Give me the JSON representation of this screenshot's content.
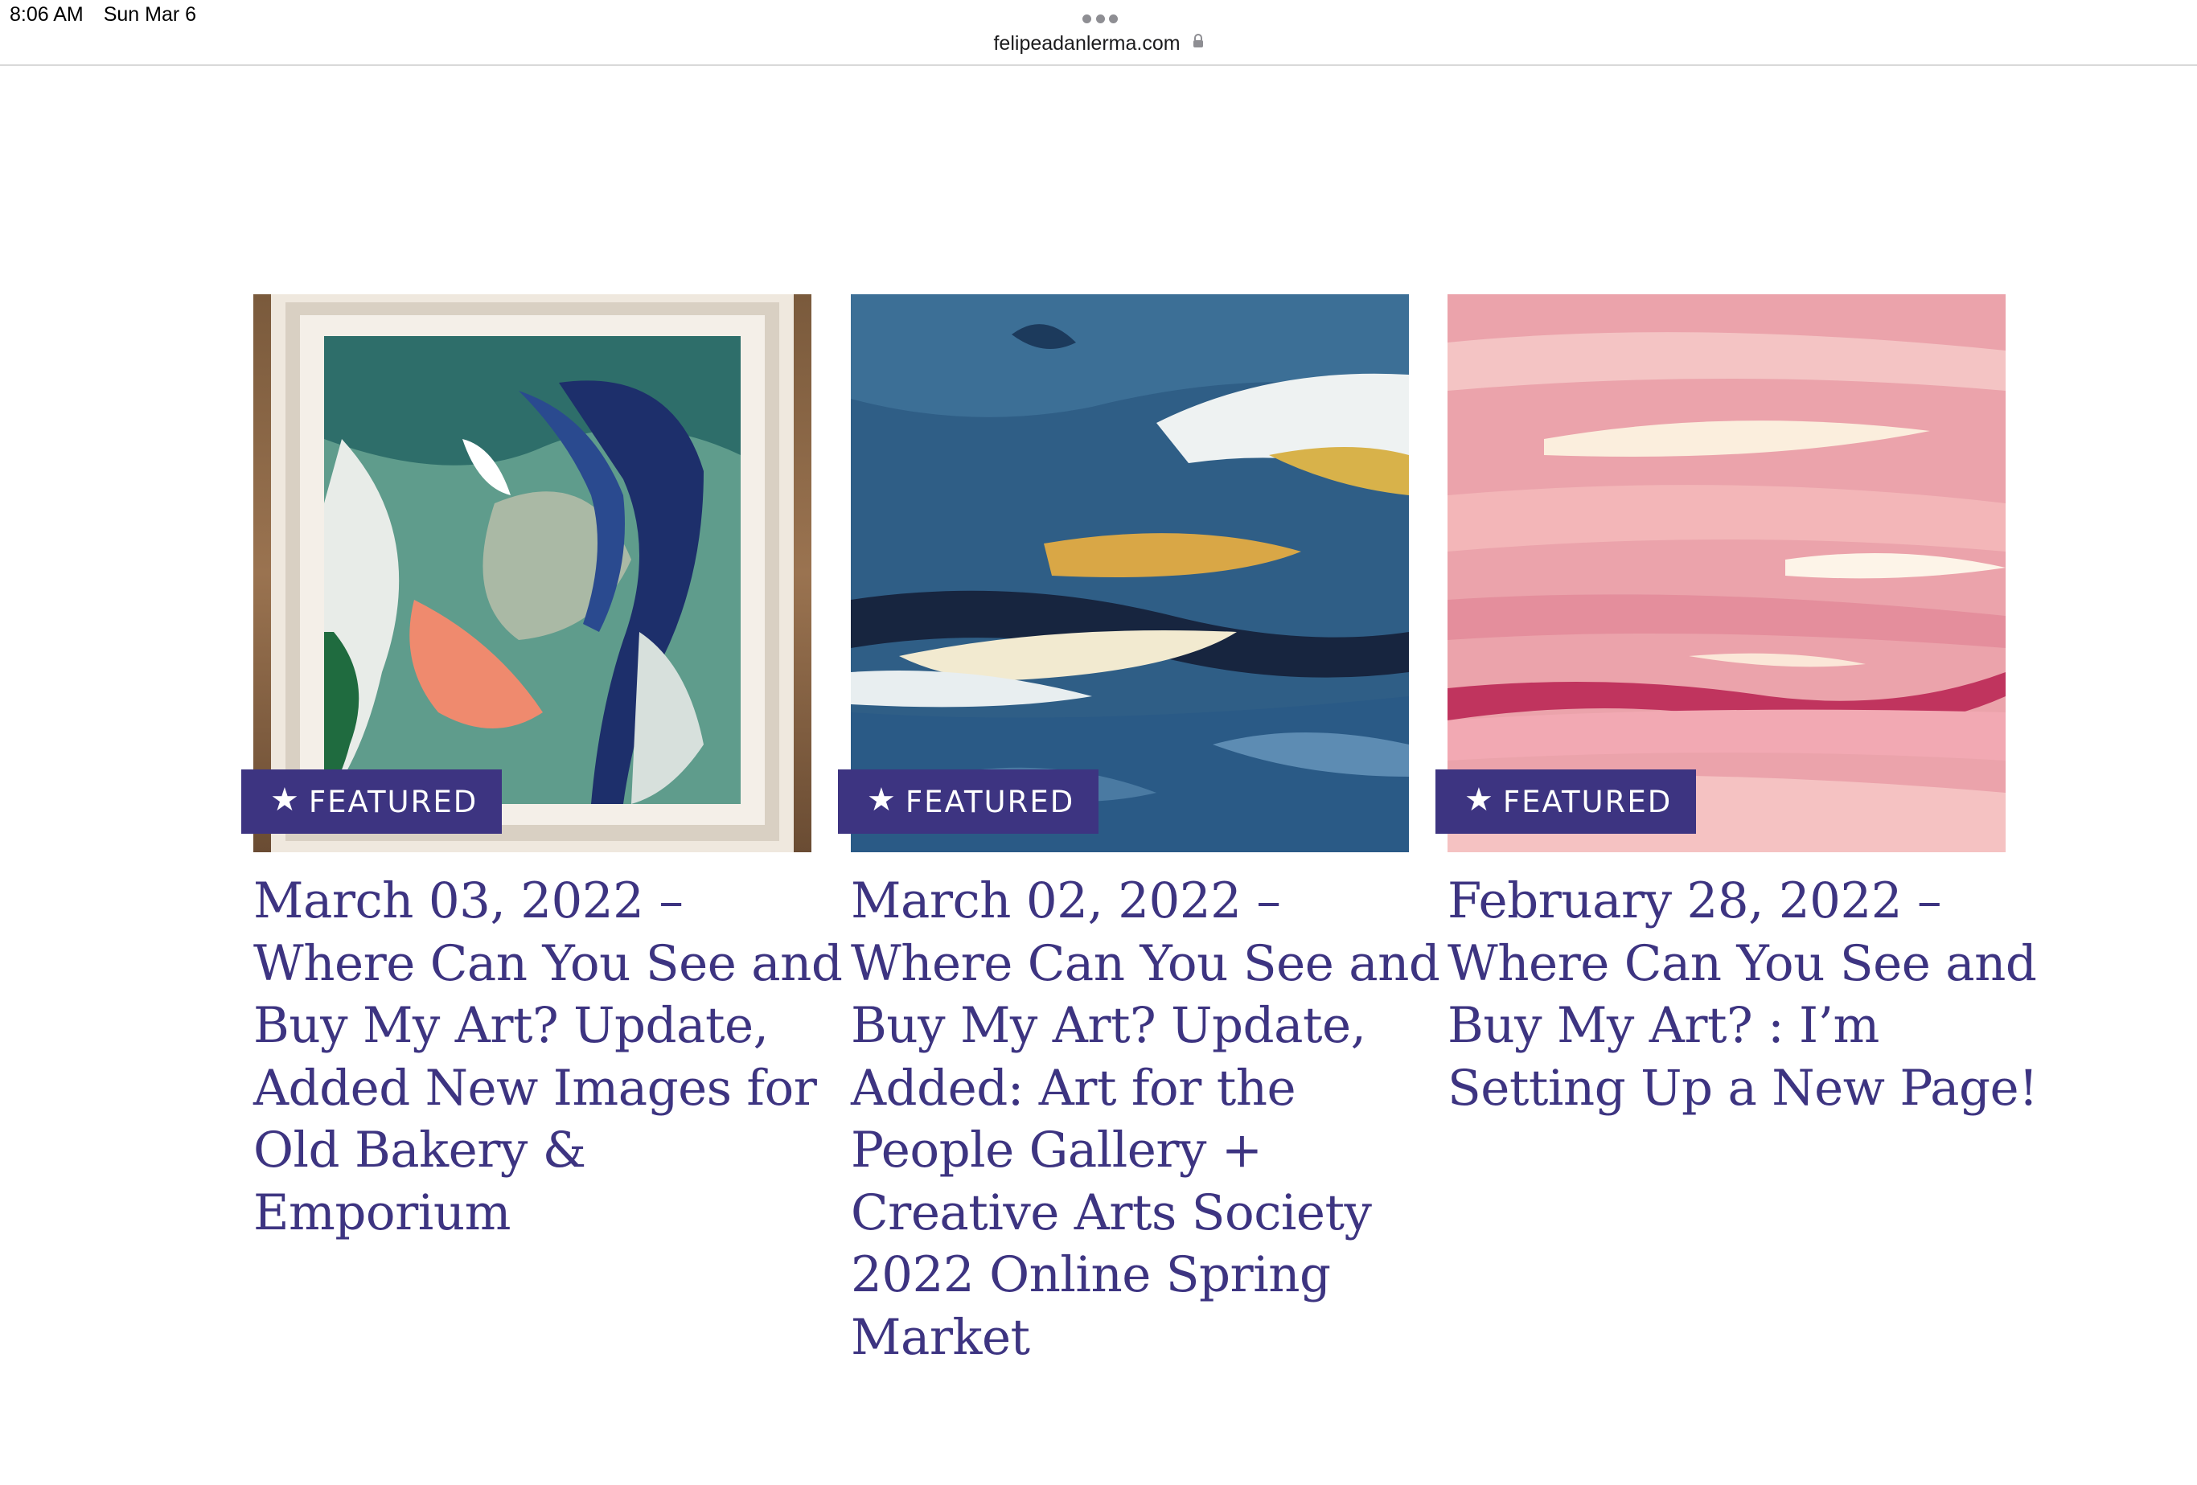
{
  "status_bar": {
    "time": "8:06 AM",
    "date": "Sun Mar 6"
  },
  "browser": {
    "url": "felipeadanlerma.com",
    "lock_icon": "lock-icon",
    "multitask_icon": "ellipsis-icon"
  },
  "colors": {
    "accent": "#3d3481",
    "badge_text": "#ffffff",
    "background": "#ffffff"
  },
  "posts": [
    {
      "badge": "FEATURED",
      "badge_icon": "star-icon",
      "image": "framed abstract painting in green, navy and coral",
      "title_lines": [
        "March 03, 2022 –",
        "Where Can You See and",
        "Buy My Art? Update,",
        "Added New Images for",
        "Old Bakery &",
        "Emporium"
      ]
    },
    {
      "badge": "FEATURED",
      "badge_icon": "star-icon",
      "image": "abstract painting in deep blue with gold and white strokes",
      "title_lines": [
        "March 02, 2022 –",
        "Where Can You See and",
        "Buy My Art? Update,",
        "Added: Art for the",
        "People Gallery +",
        "Creative Arts Society",
        "2022 Online Spring",
        "Market"
      ]
    },
    {
      "badge": "FEATURED",
      "badge_icon": "star-icon",
      "image": "abstract painting in soft pink with magenta stroke",
      "title_lines": [
        "February 28, 2022 –",
        "Where Can You See and",
        "Buy My Art? : I’m",
        "Setting Up a New Page!"
      ]
    }
  ]
}
